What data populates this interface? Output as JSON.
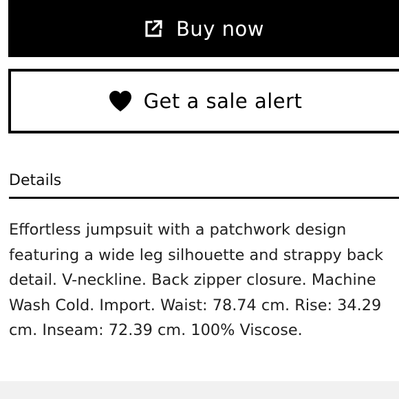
{
  "actions": {
    "buy_now_label": "Buy now",
    "buy_now_icon": "external-link-icon",
    "sale_alert_label": "Get a sale alert",
    "sale_alert_icon": "heart-icon"
  },
  "details": {
    "heading": "Details",
    "description": "Effortless jumpsuit with a patchwork design featuring a wide leg silhouette and strappy back detail. V-neckline. Back zipper closure. Machine Wash Cold. Import. Waist: 78.74 cm. Rise: 34.29 cm. Inseam: 72.39 cm. 100% Viscose."
  },
  "colors": {
    "primary": "#000000",
    "background": "#ffffff",
    "footer": "#f1f1f1"
  }
}
